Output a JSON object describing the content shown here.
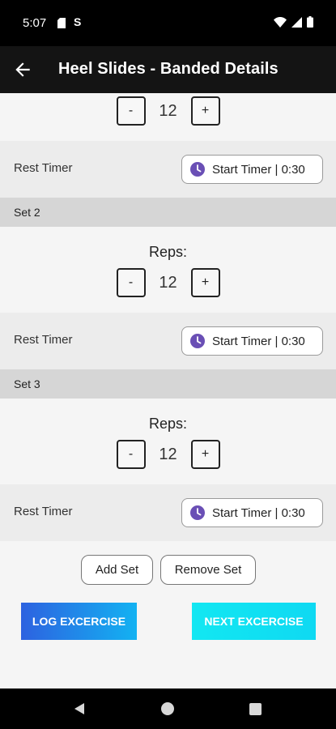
{
  "status_bar": {
    "time": "5:07"
  },
  "app_bar": {
    "title": "Heel Slides - Banded Details"
  },
  "sets": [
    {
      "header": "",
      "reps_label": "",
      "reps": "12",
      "rest_label": "Rest Timer",
      "timer_label": "Start Timer | 0:30"
    },
    {
      "header": "Set 2",
      "reps_label": "Reps:",
      "reps": "12",
      "rest_label": "Rest Timer",
      "timer_label": "Start Timer | 0:30"
    },
    {
      "header": "Set 3",
      "reps_label": "Reps:",
      "reps": "12",
      "rest_label": "Rest Timer",
      "timer_label": "Start Timer | 0:30"
    }
  ],
  "stepper": {
    "minus": "-",
    "plus": "+"
  },
  "actions": {
    "add_set": "Add Set",
    "remove_set": "Remove Set"
  },
  "buttons": {
    "log": "LOG EXCERCISE",
    "next": "NEXT EXCERCISE"
  },
  "colors": {
    "timer_icon": "#6a4fb5",
    "log_gradient_start": "#2d62e0",
    "log_gradient_end": "#13b2f2",
    "next_button": "#12e7f2"
  }
}
